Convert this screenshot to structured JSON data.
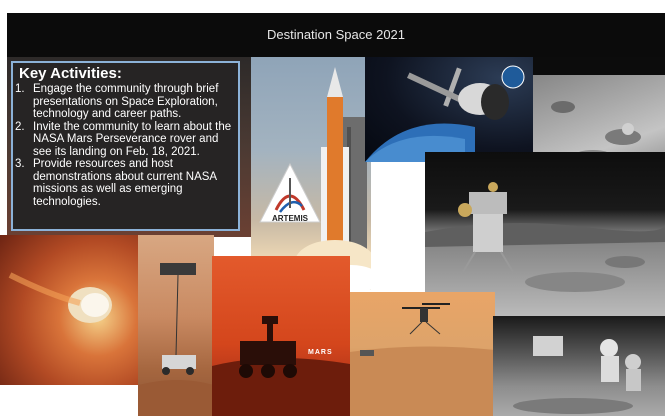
{
  "slide": {
    "title": "Destination Space 2021"
  },
  "activities": {
    "heading": "Key Activities:",
    "items": [
      {
        "num": "1.",
        "text": "Engage the community through brief presentations on Space Exploration, technology and career paths."
      },
      {
        "num": "2.",
        "text": "Invite the community to learn about the NASA Mars Perseverance rover and see its landing on Feb. 18, 2021."
      },
      {
        "num": "3.",
        "text": "Provide resources and host demonstrations about current NASA missions as well as emerging technologies."
      }
    ]
  },
  "badges": {
    "artemis": "ARTEMIS",
    "mars": "MARS"
  },
  "colors": {
    "box_border": "#8cb2d8",
    "box_bg": "#262424",
    "title_bar": "#0b0b0b"
  }
}
